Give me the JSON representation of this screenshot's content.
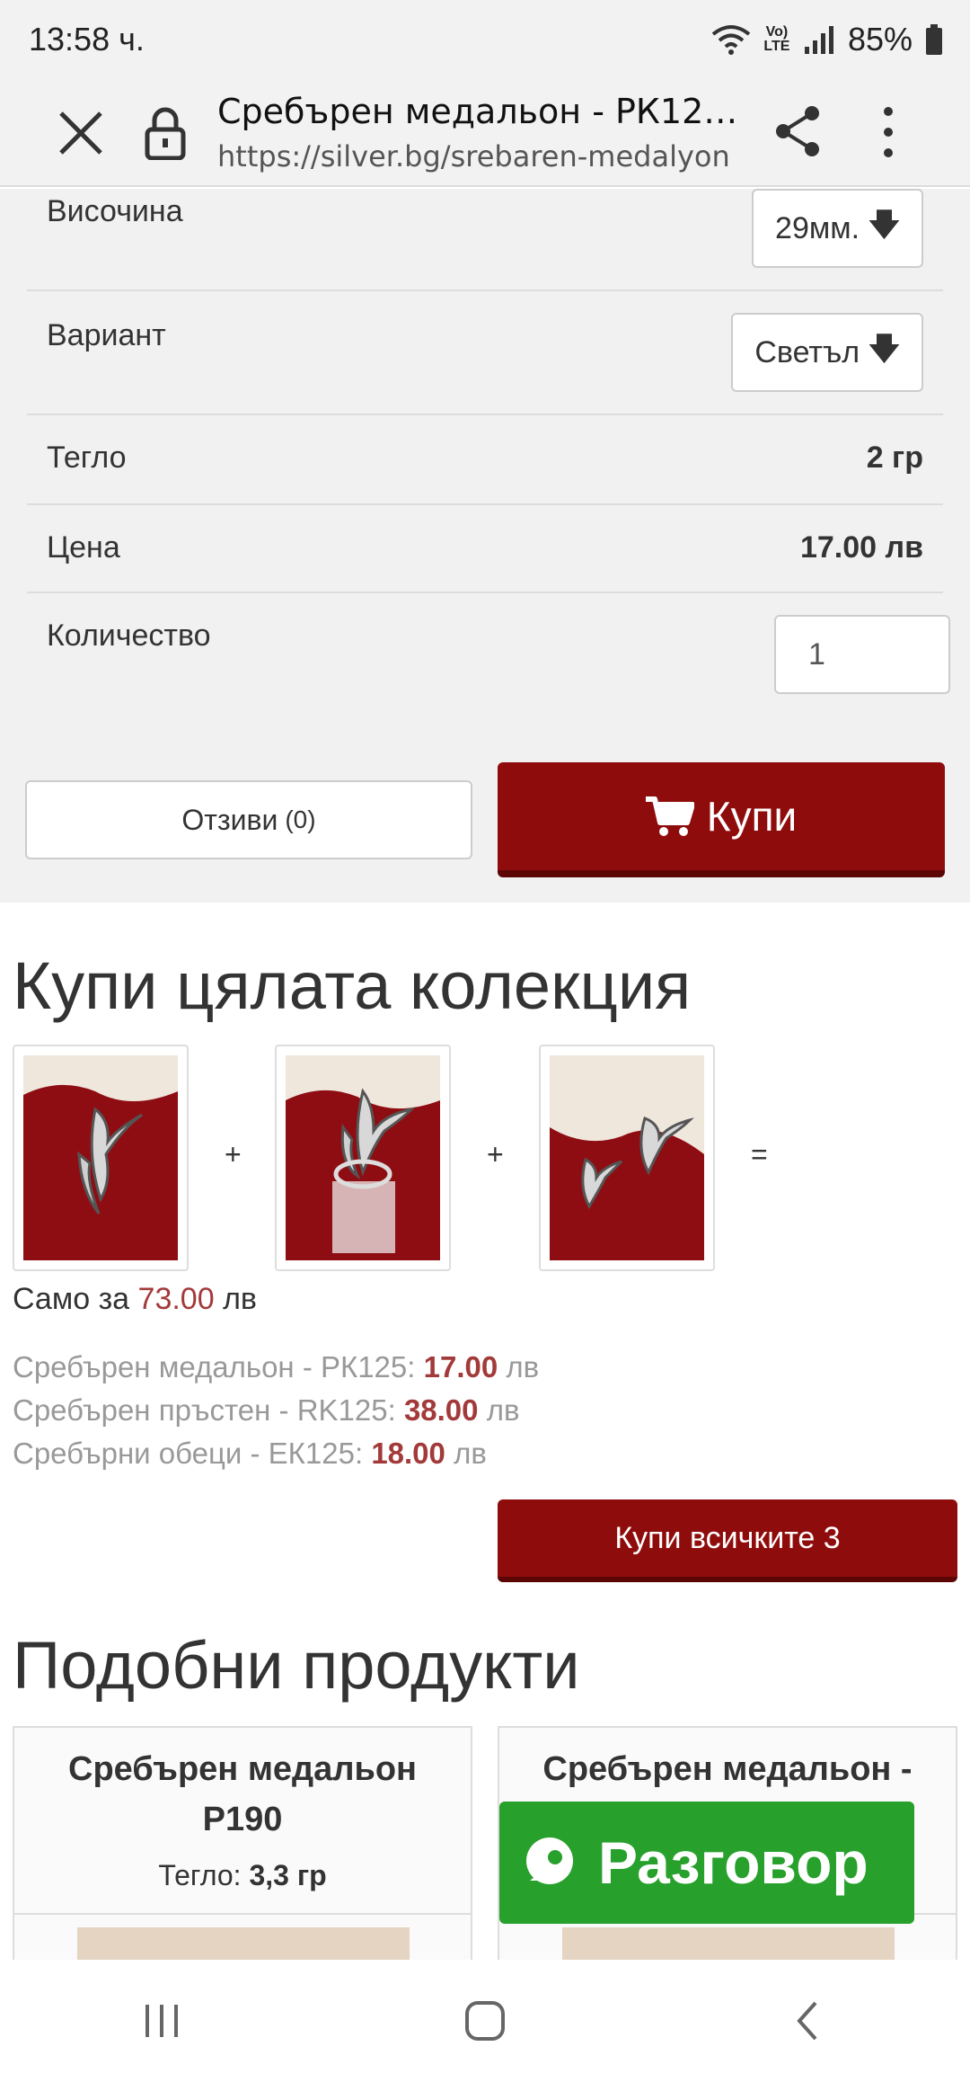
{
  "status_bar": {
    "time": "13:58 ч.",
    "battery": "85%",
    "net_label": "Vo) LTE"
  },
  "browser": {
    "page_title": "Сребърен медальон - РК125...",
    "url": "https://silver.bg/srebaren-medalyon"
  },
  "product": {
    "height_label": "Височина",
    "height_value": "29мм.",
    "variant_label": "Вариант",
    "variant_value": "Светъл",
    "weight_label": "Тегло",
    "weight_value": "2 гр",
    "price_label": "Цена",
    "price_value": "17.00 лв",
    "quantity_label": "Количество",
    "quantity_value": "1",
    "reviews_label": "Отзиви",
    "reviews_count": "(0)",
    "buy_label": "Купи"
  },
  "collection": {
    "title": "Купи цялата колекция",
    "plus": "+",
    "equals": "=",
    "only_for_label": "Само за",
    "total_price": "73.00",
    "currency": "лв",
    "items": [
      {
        "name": "Сребърен медальон - РК125:",
        "price": "17.00",
        "currency": "лв"
      },
      {
        "name": "Сребърен пръстен - RK125:",
        "price": "38.00",
        "currency": "лв"
      },
      {
        "name": "Сребърни обеци - ЕК125:",
        "price": "18.00",
        "currency": "лв"
      }
    ],
    "buy_all_label": "Купи всичките 3"
  },
  "similar": {
    "title": "Подобни продукти",
    "cards": [
      {
        "name": "Сребърен медальон Р190",
        "weight_label": "Тегло:",
        "weight_value": "3,3 гр"
      },
      {
        "name": "Сребърен медальон -"
      }
    ]
  },
  "chat": {
    "label": "Разговор"
  },
  "colors": {
    "accent": "#8f0c0c",
    "price": "#a33a3a",
    "chat": "#27a02c",
    "panel": "#f1f1f1"
  }
}
